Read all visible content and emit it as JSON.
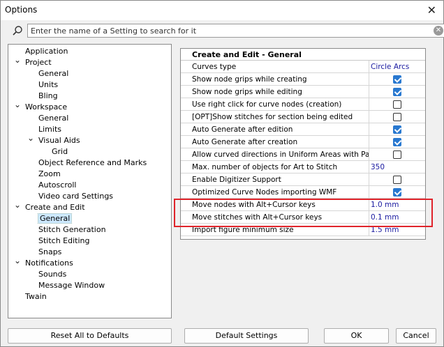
{
  "window": {
    "title": "Options"
  },
  "search": {
    "placeholder": "Enter the name of a Setting to search for it"
  },
  "tree": {
    "items": [
      {
        "label": "Application",
        "level": 0,
        "expanded": null,
        "selected": false
      },
      {
        "label": "Project",
        "level": 0,
        "expanded": true,
        "selected": false
      },
      {
        "label": "General",
        "level": 1,
        "expanded": null,
        "selected": false
      },
      {
        "label": "Units",
        "level": 1,
        "expanded": null,
        "selected": false
      },
      {
        "label": "Bling",
        "level": 1,
        "expanded": null,
        "selected": false
      },
      {
        "label": "Workspace",
        "level": 0,
        "expanded": true,
        "selected": false
      },
      {
        "label": "General",
        "level": 1,
        "expanded": null,
        "selected": false
      },
      {
        "label": "Limits",
        "level": 1,
        "expanded": null,
        "selected": false
      },
      {
        "label": "Visual Aids",
        "level": 1,
        "expanded": true,
        "selected": false
      },
      {
        "label": "Grid",
        "level": 2,
        "expanded": null,
        "selected": false
      },
      {
        "label": "Object Reference and Marks",
        "level": 1,
        "expanded": null,
        "selected": false
      },
      {
        "label": "Zoom",
        "level": 1,
        "expanded": null,
        "selected": false
      },
      {
        "label": "Autoscroll",
        "level": 1,
        "expanded": null,
        "selected": false
      },
      {
        "label": "Video card Settings",
        "level": 1,
        "expanded": null,
        "selected": false
      },
      {
        "label": "Create and Edit",
        "level": 0,
        "expanded": true,
        "selected": false
      },
      {
        "label": "General",
        "level": 1,
        "expanded": null,
        "selected": true
      },
      {
        "label": "Stitch Generation",
        "level": 1,
        "expanded": null,
        "selected": false
      },
      {
        "label": "Stitch Editing",
        "level": 1,
        "expanded": null,
        "selected": false
      },
      {
        "label": "Snaps",
        "level": 1,
        "expanded": null,
        "selected": false
      },
      {
        "label": "Notifications",
        "level": 0,
        "expanded": true,
        "selected": false
      },
      {
        "label": "Sounds",
        "level": 1,
        "expanded": null,
        "selected": false
      },
      {
        "label": "Message Window",
        "level": 1,
        "expanded": null,
        "selected": false
      },
      {
        "label": "Twain",
        "level": 0,
        "expanded": null,
        "selected": false
      }
    ]
  },
  "grid": {
    "header": "Create and Edit - General",
    "rows": [
      {
        "name": "Curves type",
        "kind": "text",
        "value": "Circle Arcs"
      },
      {
        "name": "Show node grips while creating",
        "kind": "check",
        "checked": true
      },
      {
        "name": "Show node grips while editing",
        "kind": "check",
        "checked": true
      },
      {
        "name": "Use right click for curve nodes (creation)",
        "kind": "check",
        "checked": false
      },
      {
        "name": "[OPT]Show stitches for section being edited",
        "kind": "check",
        "checked": false
      },
      {
        "name": "Auto Generate after edition",
        "kind": "check",
        "checked": true
      },
      {
        "name": "Auto Generate after creation",
        "kind": "check",
        "checked": true
      },
      {
        "name": "Allow curved directions in Uniform Areas with Pattern",
        "kind": "check",
        "checked": false
      },
      {
        "name": "Max. number of objects for Art to Stitch",
        "kind": "text",
        "value": "350"
      },
      {
        "name": "Enable Digitizer Support",
        "kind": "check",
        "checked": false
      },
      {
        "name": "Optimized Curve Nodes importing WMF",
        "kind": "check",
        "checked": true
      },
      {
        "name": "Move nodes with Alt+Cursor keys",
        "kind": "text",
        "value": "1.0 mm"
      },
      {
        "name": "Move stitches with Alt+Cursor keys",
        "kind": "text",
        "value": "0.1 mm"
      },
      {
        "name": "Import figure minimum size",
        "kind": "text",
        "value": "1.5 mm"
      }
    ]
  },
  "buttons": {
    "reset": "Reset All to Defaults",
    "default": "Default Settings",
    "ok": "OK",
    "cancel": "Cancel"
  },
  "colors": {
    "highlight": "#e0232a",
    "checkbox": "#2878d0",
    "value_text": "#1a1aa0",
    "selection": "#cce8ff"
  }
}
